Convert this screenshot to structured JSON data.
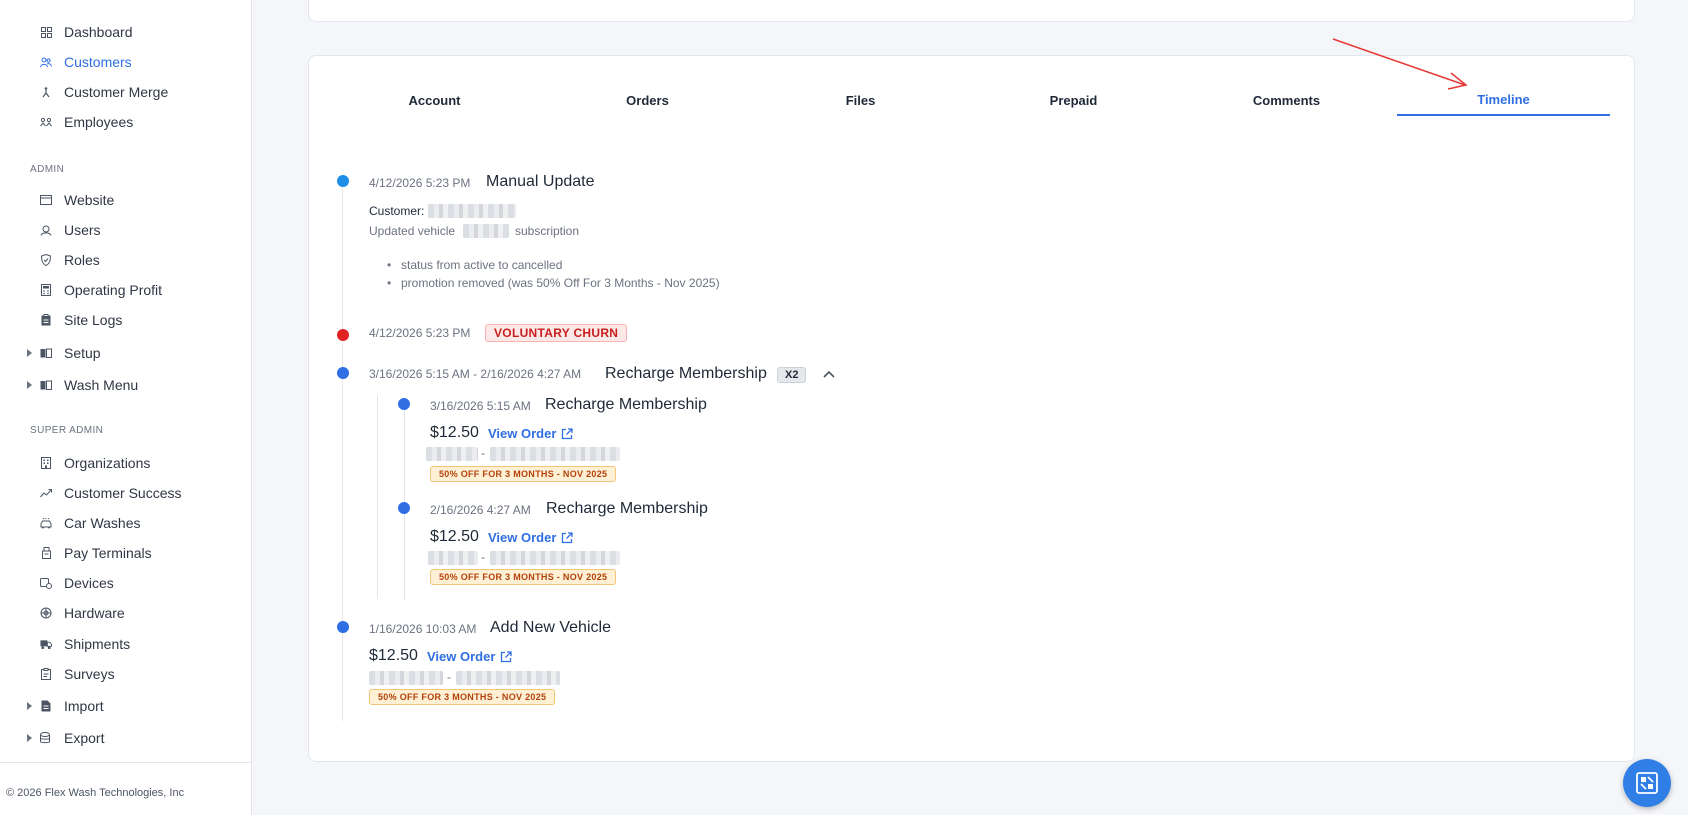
{
  "sidebar": {
    "items": [
      {
        "label": "Dashboard",
        "icon": "dashboard-icon"
      },
      {
        "label": "Customers",
        "icon": "customers-icon",
        "active": true
      },
      {
        "label": "Customer Merge",
        "icon": "merge-icon"
      },
      {
        "label": "Employees",
        "icon": "employees-icon"
      }
    ],
    "admin_label": "ADMIN",
    "admin_items": [
      {
        "label": "Website",
        "icon": "website-icon"
      },
      {
        "label": "Users",
        "icon": "users-icon"
      },
      {
        "label": "Roles",
        "icon": "shield-icon"
      },
      {
        "label": "Operating Profit",
        "icon": "calculator-icon"
      },
      {
        "label": "Site Logs",
        "icon": "clipboard-icon"
      },
      {
        "label": "Setup",
        "icon": "book-icon"
      },
      {
        "label": "Wash Menu",
        "icon": "book-icon"
      }
    ],
    "super_admin_label": "SUPER ADMIN",
    "super_admin_items": [
      {
        "label": "Organizations",
        "icon": "building-icon"
      },
      {
        "label": "Customer Success",
        "icon": "trend-icon"
      },
      {
        "label": "Car Washes",
        "icon": "car-icon"
      },
      {
        "label": "Pay Terminals",
        "icon": "terminal-icon"
      },
      {
        "label": "Devices",
        "icon": "devices-icon"
      },
      {
        "label": "Hardware",
        "icon": "hardware-icon"
      },
      {
        "label": "Shipments",
        "icon": "truck-icon"
      },
      {
        "label": "Surveys",
        "icon": "survey-icon"
      },
      {
        "label": "Import",
        "icon": "import-icon"
      },
      {
        "label": "Export",
        "icon": "export-icon"
      }
    ],
    "copyright": "© 2026 Flex Wash Technologies, Inc"
  },
  "tabs": [
    {
      "label": "Account"
    },
    {
      "label": "Orders"
    },
    {
      "label": "Files"
    },
    {
      "label": "Prepaid"
    },
    {
      "label": "Comments"
    },
    {
      "label": "Timeline",
      "active": true
    }
  ],
  "timeline": {
    "e1": {
      "timestamp": "4/12/2026 5:23 PM",
      "title": "Manual Update",
      "customer_label": "Customer:",
      "updated_prefix": "Updated vehicle",
      "updated_suffix": "subscription",
      "bullets": [
        "status from active to cancelled",
        "promotion removed (was 50% Off For 3 Months - Nov 2025)"
      ]
    },
    "e2": {
      "timestamp": "4/12/2026 5:23 PM",
      "badge": "VOLUNTARY CHURN"
    },
    "e3": {
      "timestamp": "3/16/2026 5:15 AM - 2/16/2026 4:27 AM",
      "title": "Recharge Membership",
      "count_badge": "X2",
      "children": [
        {
          "timestamp": "3/16/2026 5:15 AM",
          "title": "Recharge Membership",
          "price": "$12.50",
          "link": "View Order",
          "separator": "-",
          "promo": "50% OFF FOR 3 MONTHS - NOV 2025"
        },
        {
          "timestamp": "2/16/2026 4:27 AM",
          "title": "Recharge Membership",
          "price": "$12.50",
          "link": "View Order",
          "separator": "-",
          "promo": "50% OFF FOR 3 MONTHS - NOV 2025"
        }
      ]
    },
    "e4": {
      "timestamp": "1/16/2026 10:03 AM",
      "title": "Add New Vehicle",
      "price": "$12.50",
      "link": "View Order",
      "separator": "-",
      "promo": "50% OFF FOR 3 MONTHS - NOV 2025"
    }
  },
  "colors": {
    "accent": "#2f6fe3",
    "churn_red": "#e02424",
    "annotation_arrow": "#e53935"
  }
}
